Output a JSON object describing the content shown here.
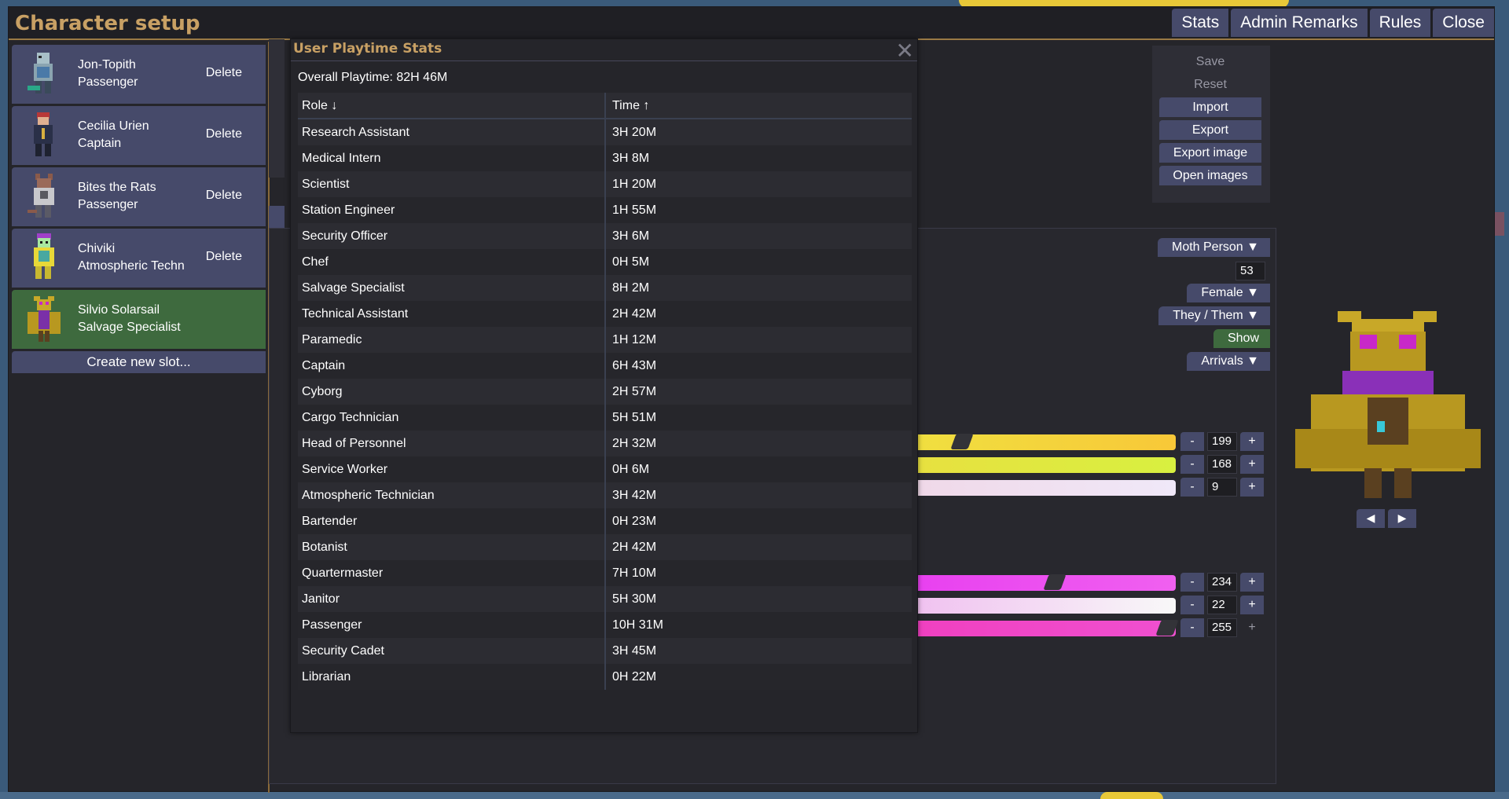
{
  "window": {
    "title": "Character setup",
    "top_buttons": [
      "Stats",
      "Admin Remarks",
      "Rules",
      "Close"
    ]
  },
  "slots": [
    {
      "name": "Jon-Topith",
      "job": "Passenger",
      "delete_label": "Delete",
      "active": false
    },
    {
      "name": "Cecilia Urien",
      "job": "Captain",
      "delete_label": "Delete",
      "active": false
    },
    {
      "name": "Bites the Rats",
      "job": "Passenger",
      "delete_label": "Delete",
      "active": false
    },
    {
      "name": "Chiviki",
      "job": "Atmospheric Techn",
      "delete_label": "Delete",
      "active": false
    },
    {
      "name": "Silvio Solarsail",
      "job": "Salvage Specialist",
      "delete_label": "",
      "active": true
    }
  ],
  "create_slot_label": "Create new slot...",
  "actions": {
    "save": "Save",
    "reset": "Reset",
    "import": "Import",
    "export": "Export",
    "export_image": "Export image",
    "open_images": "Open images"
  },
  "appearance": {
    "species": "Moth Person",
    "age": "53",
    "sex": "Female",
    "pronouns": "They / Them",
    "show_label": "Show",
    "spawn": "Arrivals",
    "sliders_1": [
      {
        "value": "199",
        "level": 0.18,
        "color_from": "#f0e040",
        "color_to": "#f8c838"
      },
      {
        "value": "168",
        "level": 1.0,
        "color_from": "#e8e040",
        "color_to": "#d8f040"
      },
      {
        "value": "9",
        "level": 1.0,
        "color_from": "#f0d8e8",
        "color_to": "#f0e8f8"
      }
    ],
    "sliders_2": [
      {
        "value": "234",
        "level": 0.55,
        "color_from": "#e840f0",
        "color_to": "#f060f0"
      },
      {
        "value": "22",
        "level": 1.0,
        "color_from": "#f0c0f0",
        "color_to": "#f8f8f8"
      },
      {
        "value": "255",
        "level": 1.0,
        "color_from": "#f040c0",
        "color_to": "#f050d0"
      }
    ],
    "minus_label": "-",
    "plus_label": "+"
  },
  "dialog": {
    "title": "User Playtime Stats",
    "overall": "Overall Playtime: 82H 46M",
    "columns": [
      "Role ↓",
      "Time ↑"
    ],
    "rows": [
      [
        "Research Assistant",
        "3H 20M"
      ],
      [
        "Medical Intern",
        "3H 8M"
      ],
      [
        "Scientist",
        "1H 20M"
      ],
      [
        "Station Engineer",
        "1H 55M"
      ],
      [
        "Security Officer",
        "3H 6M"
      ],
      [
        "Chef",
        "0H 5M"
      ],
      [
        "Salvage Specialist",
        "8H 2M"
      ],
      [
        "Technical Assistant",
        "2H 42M"
      ],
      [
        "Paramedic",
        "1H 12M"
      ],
      [
        "Captain",
        "6H 43M"
      ],
      [
        "Cyborg",
        "2H 57M"
      ],
      [
        "Cargo Technician",
        "5H 51M"
      ],
      [
        "Head of Personnel",
        "2H 32M"
      ],
      [
        "Service Worker",
        "0H 6M"
      ],
      [
        "Atmospheric Technician",
        "3H 42M"
      ],
      [
        "Bartender",
        "0H 23M"
      ],
      [
        "Botanist",
        "2H 42M"
      ],
      [
        "Quartermaster",
        "7H 10M"
      ],
      [
        "Janitor",
        "5H 30M"
      ],
      [
        "Passenger",
        "10H 31M"
      ],
      [
        "Security Cadet",
        "3H 45M"
      ],
      [
        "Librarian",
        "0H 22M"
      ]
    ]
  },
  "icons": {
    "close": "close-icon",
    "dropdown": "triangle-down-icon",
    "prev": "triangle-left-icon",
    "next": "triangle-right-icon"
  }
}
